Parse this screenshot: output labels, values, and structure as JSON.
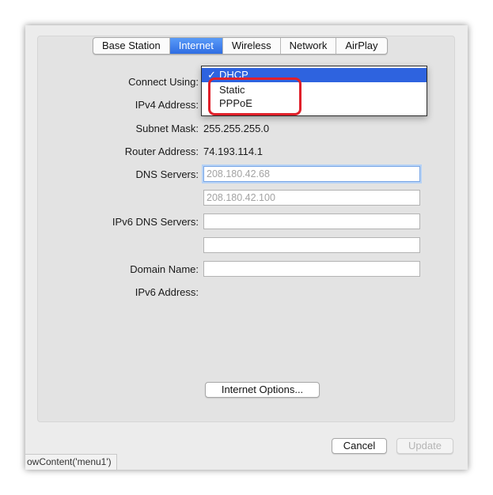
{
  "tabs": [
    "Base Station",
    "Internet",
    "Wireless",
    "Network",
    "AirPlay"
  ],
  "active_tab": "Internet",
  "form": {
    "connect_using_label": "Connect Using:",
    "ipv4_label": "IPv4 Address:",
    "subnet_label": "Subnet Mask:",
    "subnet_value": "255.255.255.0",
    "router_label": "Router Address:",
    "router_value": "74.193.114.1",
    "dns_label": "DNS Servers:",
    "dns1_placeholder": "208.180.42.68",
    "dns2_placeholder": "208.180.42.100",
    "ipv6_dns_label": "IPv6 DNS Servers:",
    "domain_label": "Domain Name:",
    "ipv6_address_label": "IPv6 Address:"
  },
  "menu": {
    "items": [
      "DHCP",
      "Static",
      "PPPoE"
    ],
    "selected": "DHCP",
    "check_glyph": "✓"
  },
  "buttons": {
    "internet_options": "Internet Options...",
    "cancel": "Cancel",
    "update": "Update"
  },
  "status_text": "owContent('menu1')",
  "colors": {
    "accent": "#2f6de2",
    "highlight": "#e0202a"
  }
}
